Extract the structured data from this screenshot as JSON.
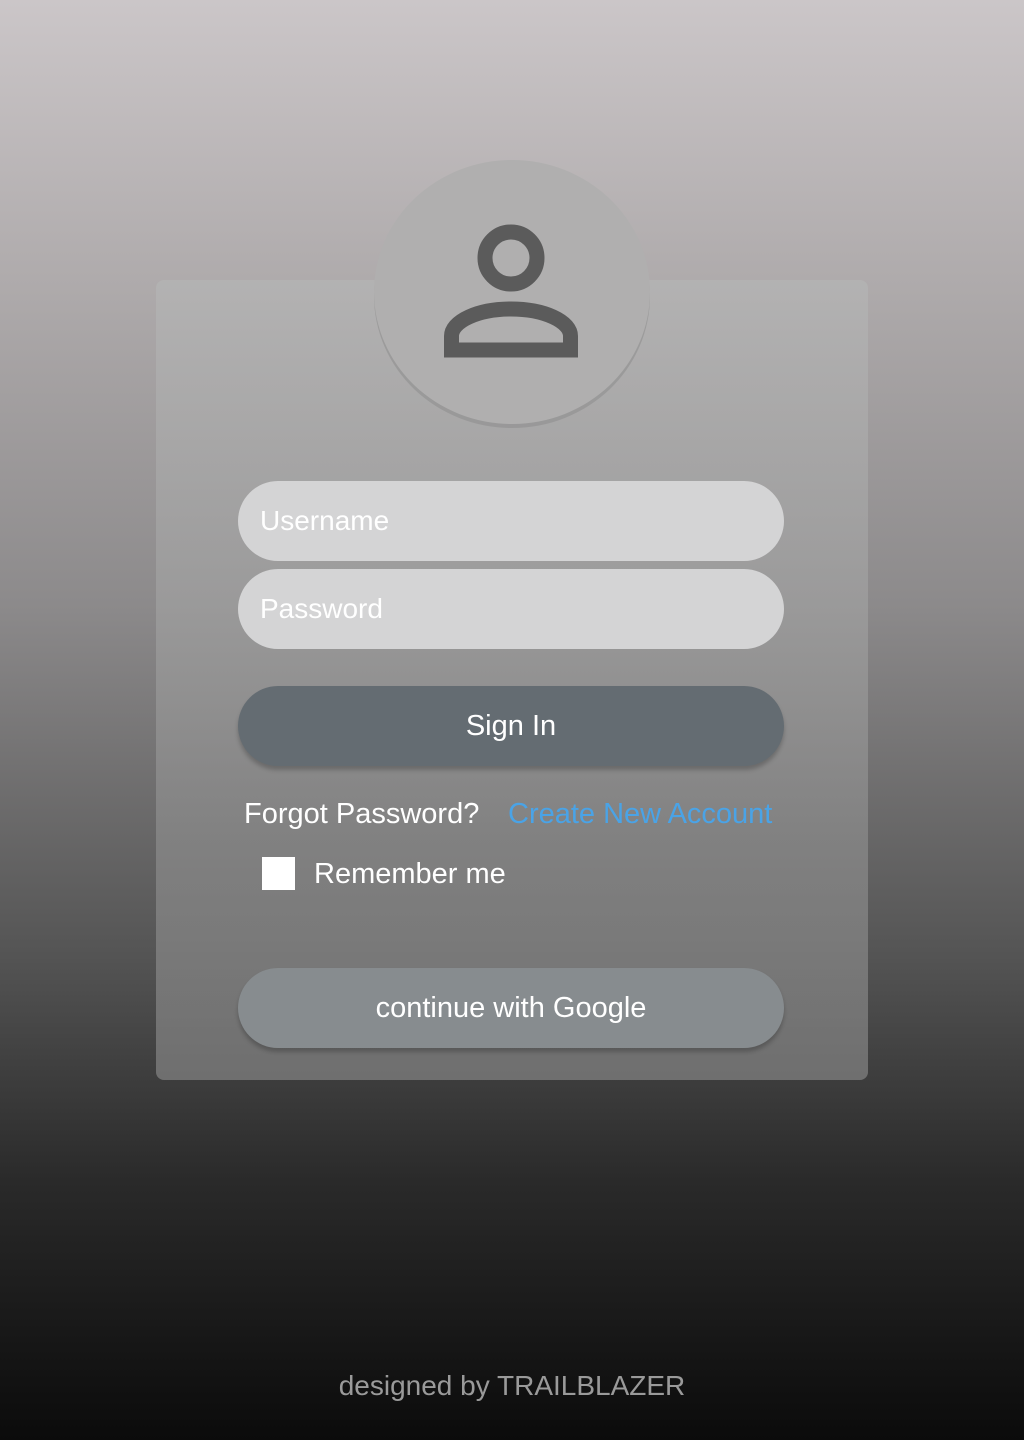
{
  "avatar": {
    "icon": "user-icon"
  },
  "login_form": {
    "username_placeholder": "Username",
    "password_placeholder": "Password",
    "sign_in_label": "Sign In",
    "forgot_password_label": "Forgot Password?",
    "create_account_label": "Create New Account",
    "remember_me_label": "Remember me",
    "remember_me_checked": false,
    "google_label": "continue with Google"
  },
  "footer": {
    "credit": "designed by TRAILBLAZER"
  },
  "colors": {
    "sign_in_button": "#646c72",
    "google_button": "#878c8f",
    "link": "#4aa3e6",
    "field_background": "#d4d4d5"
  }
}
